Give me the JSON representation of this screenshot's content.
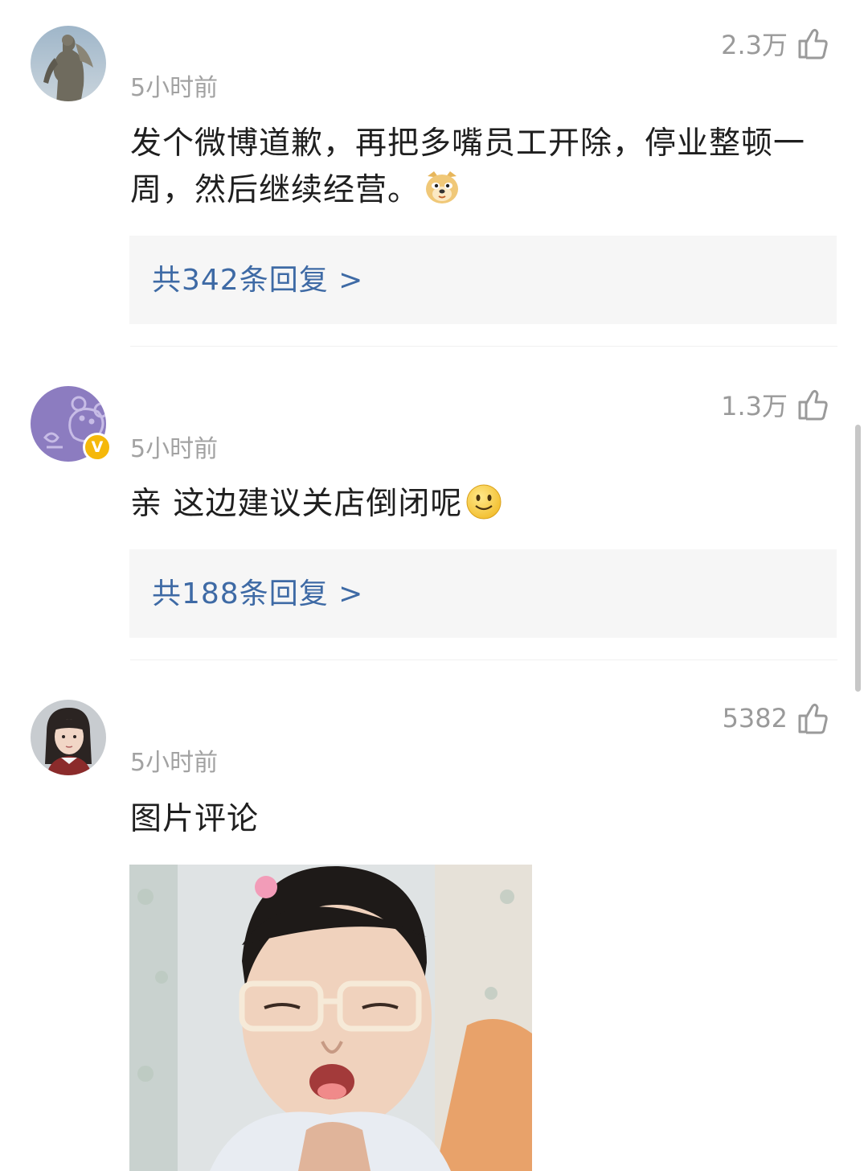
{
  "comments": [
    {
      "likes": "2.3万",
      "time": "5小时前",
      "text": "发个微博道歉，再把多嘴员工开除，停业整顿一周，然后继续经营。",
      "emoji": "doge-emoji",
      "replies": "共342条回复 >"
    },
    {
      "likes": "1.3万",
      "time": "5小时前",
      "verified_badge": "V",
      "text": "亲 这边建议关店倒闭呢",
      "emoji": "smile-emoji",
      "replies": "共188条回复 >"
    },
    {
      "likes": "5382",
      "time": "5小时前",
      "text": "图片评论",
      "image": "meme-girl-glasses"
    }
  ],
  "colors": {
    "link": "#3e6aa5",
    "meta": "#a2a2a2",
    "reply_bg": "#f6f6f6",
    "verified": "#f5b80a"
  }
}
